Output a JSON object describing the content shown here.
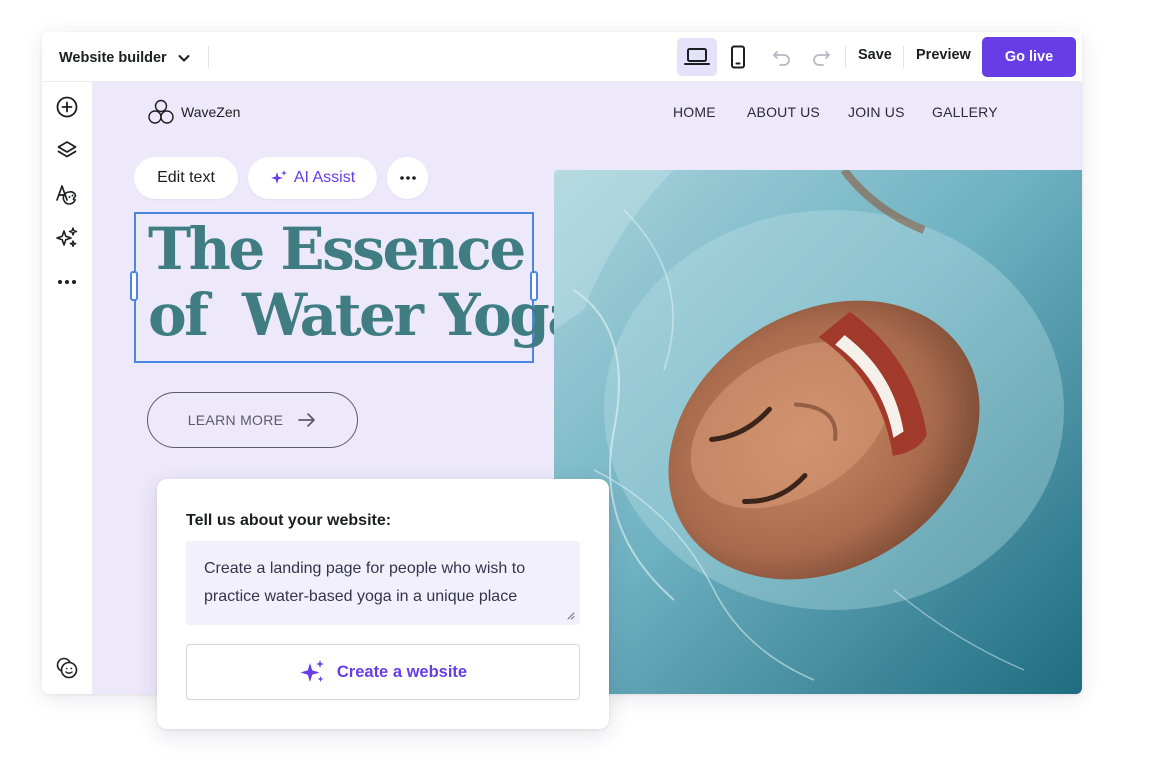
{
  "toolbar": {
    "builder_select_label": "Website builder",
    "save_label": "Save",
    "preview_label": "Preview",
    "go_live_label": "Go live",
    "accent_color": "#673de6"
  },
  "canvas": {
    "logo_text": "WaveZen",
    "nav": [
      "HOME",
      "ABOUT US",
      "JOIN US",
      "GALLERY"
    ],
    "edit_text_label": "Edit text",
    "ai_assist_label": "AI Assist",
    "headline_line1": "The Essence",
    "headline_line2": "of  Water Yoga",
    "learn_more_label": "LEARN MORE",
    "background_color": "#ede9fb",
    "headline_color": "#3f7d82"
  },
  "prompt": {
    "label": "Tell us about your website:",
    "text": "Create a landing page for people who wish to practice water-based yoga in a unique place",
    "create_button_label": "Create a website"
  }
}
